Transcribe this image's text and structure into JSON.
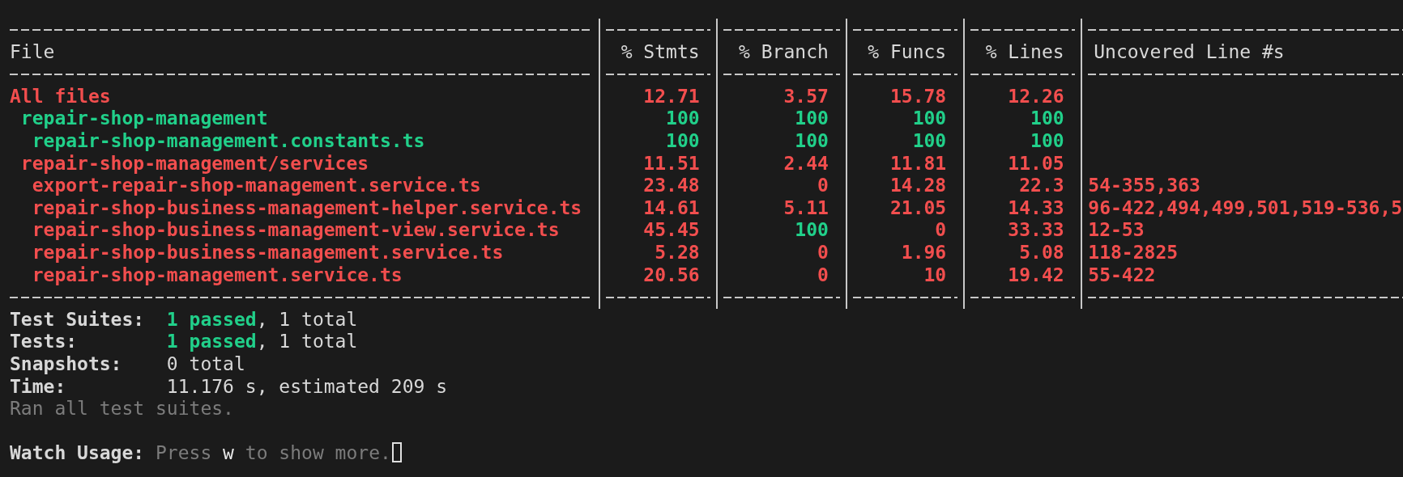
{
  "table": {
    "columns": [
      "File",
      "% Stmts",
      "% Branch",
      "% Funcs",
      "% Lines",
      "Uncovered Line #s"
    ],
    "rows": [
      {
        "name": "All files",
        "color": "#f24e4e",
        "metrics": [
          {
            "value": "12.71",
            "color": "#f24e4e"
          },
          {
            "value": "3.57",
            "color": "#f24e4e"
          },
          {
            "value": "15.78",
            "color": "#f24e4e"
          },
          {
            "value": "12.26",
            "color": "#f24e4e"
          }
        ],
        "children": [
          {
            "name": "repair-shop-management",
            "color": "#21d08a",
            "metrics": [
              {
                "value": "100",
                "color": "#21d08a"
              },
              {
                "value": "100",
                "color": "#21d08a"
              },
              {
                "value": "100",
                "color": "#21d08a"
              },
              {
                "value": "100",
                "color": "#21d08a"
              }
            ],
            "children": [
              {
                "name": "repair-shop-management.constants.ts",
                "color": "#21d08a",
                "metrics": [
                  {
                    "value": "100",
                    "color": "#21d08a"
                  },
                  {
                    "value": "100",
                    "color": "#21d08a"
                  },
                  {
                    "value": "100",
                    "color": "#21d08a"
                  },
                  {
                    "value": "100",
                    "color": "#21d08a"
                  }
                ]
              }
            ]
          },
          {
            "name": "repair-shop-management/services",
            "color": "#f24e4e",
            "metrics": [
              {
                "value": "11.51",
                "color": "#f24e4e"
              },
              {
                "value": "2.44",
                "color": "#f24e4e"
              },
              {
                "value": "11.81",
                "color": "#f24e4e"
              },
              {
                "value": "11.05",
                "color": "#f24e4e"
              }
            ],
            "children": [
              {
                "name": "export-repair-shop-management.service.ts",
                "color": "#f24e4e",
                "metrics": [
                  {
                    "value": "23.48",
                    "color": "#f24e4e"
                  },
                  {
                    "value": "0",
                    "color": "#f24e4e"
                  },
                  {
                    "value": "14.28",
                    "color": "#f24e4e"
                  },
                  {
                    "value": "22.3",
                    "color": "#f24e4e"
                  }
                ],
                "uncovered": "54-355,363"
              },
              {
                "name": "repair-shop-business-management-helper.service.ts",
                "color": "#f24e4e",
                "metrics": [
                  {
                    "value": "14.61",
                    "color": "#f24e4e"
                  },
                  {
                    "value": "5.11",
                    "color": "#f24e4e"
                  },
                  {
                    "value": "21.05",
                    "color": "#f24e4e"
                  },
                  {
                    "value": "14.33",
                    "color": "#f24e4e"
                  }
                ],
                "uncovered": "96-422,494,499,501,519-536,5"
              },
              {
                "name": "repair-shop-business-management-view.service.ts",
                "color": "#f24e4e",
                "metrics": [
                  {
                    "value": "45.45",
                    "color": "#f24e4e"
                  },
                  {
                    "value": "100",
                    "color": "#21d08a"
                  },
                  {
                    "value": "0",
                    "color": "#f24e4e"
                  },
                  {
                    "value": "33.33",
                    "color": "#f24e4e"
                  }
                ],
                "uncovered": "12-53"
              },
              {
                "name": "repair-shop-business-management.service.ts",
                "color": "#f24e4e",
                "metrics": [
                  {
                    "value": "5.28",
                    "color": "#f24e4e"
                  },
                  {
                    "value": "0",
                    "color": "#f24e4e"
                  },
                  {
                    "value": "1.96",
                    "color": "#f24e4e"
                  },
                  {
                    "value": "5.08",
                    "color": "#f24e4e"
                  }
                ],
                "uncovered": "118-2825"
              },
              {
                "name": "repair-shop-management.service.ts",
                "color": "#f24e4e",
                "metrics": [
                  {
                    "value": "20.56",
                    "color": "#f24e4e"
                  },
                  {
                    "value": "0",
                    "color": "#f24e4e"
                  },
                  {
                    "value": "10",
                    "color": "#f24e4e"
                  },
                  {
                    "value": "19.42",
                    "color": "#f24e4e"
                  }
                ],
                "uncovered": "55-422"
              }
            ]
          }
        ]
      }
    ]
  },
  "summary": [
    {
      "label": "Test Suites:",
      "parts": [
        {
          "text": "1 passed",
          "kind": "passed"
        },
        {
          "text": ", 1 total",
          "kind": "plain"
        }
      ]
    },
    {
      "label": "Tests:",
      "parts": [
        {
          "text": "1 passed",
          "kind": "passed"
        },
        {
          "text": ", 1 total",
          "kind": "plain"
        }
      ]
    },
    {
      "label": "Snapshots:",
      "parts": [
        {
          "text": "0 total",
          "kind": "plain"
        }
      ]
    },
    {
      "label": "Time:",
      "parts": [
        {
          "text": "11.176 s, estimated 209 s",
          "kind": "plain"
        }
      ]
    }
  ],
  "status_line": "Ran all test suites.",
  "watch": {
    "label": "Watch Usage:",
    "parts": [
      {
        "text": "Press ",
        "kind": "dim"
      },
      {
        "text": "w",
        "kind": "key"
      },
      {
        "text": " to show more.",
        "kind": "dim"
      }
    ],
    "cursor": true
  }
}
